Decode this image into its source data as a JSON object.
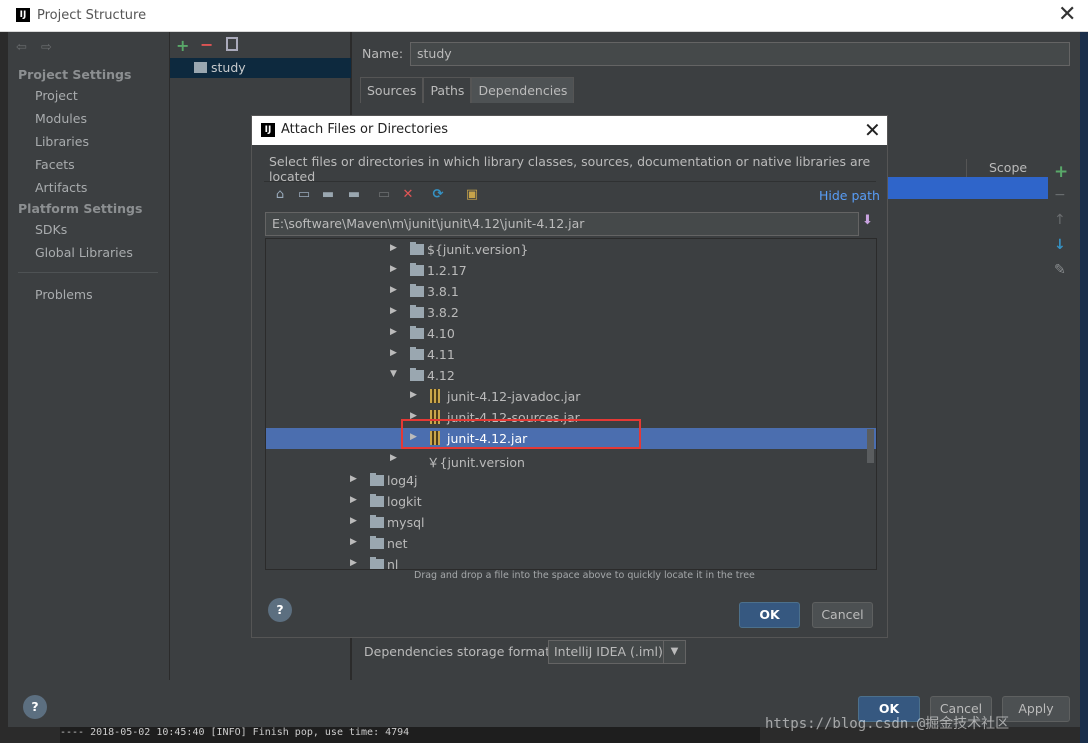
{
  "main": {
    "window_title": "Project Structure",
    "close_glyph": "✕",
    "logo": "IJ",
    "nav_back": "⇦",
    "nav_forward": "⇨",
    "nav": {
      "project_settings": "Project Settings",
      "project": "Project",
      "modules": "Modules",
      "libraries": "Libraries",
      "facets": "Facets",
      "artifacts": "Artifacts",
      "platform_settings": "Platform Settings",
      "sdks": "SDKs",
      "global_libraries": "Global Libraries",
      "problems": "Problems"
    },
    "module": "study",
    "name_label": "Name:",
    "name_value": "study",
    "tabs": [
      "Sources",
      "Paths",
      "Dependencies"
    ],
    "scope_header": "Scope",
    "storage_label": "Dependencies storage format:",
    "storage_value": "IntelliJ IDEA (.iml)",
    "buttons": {
      "ok": "OK",
      "cancel": "Cancel",
      "apply": "Apply"
    },
    "help": "?",
    "console": "---- 2018-05-02 10:45:40 [INFO] Finish pop, use time: 4794",
    "watermark": "https://blog.csdn.@掘金技术社区"
  },
  "dialog": {
    "title": "Attach Files or Directories",
    "logo": "IJ",
    "close_glyph": "✕",
    "description": "Select files or directories in which library classes, sources, documentation or native libraries are located",
    "hide_path": "Hide path",
    "path": "E:\\software\\Maven\\m\\junit\\junit\\4.12\\junit-4.12.jar",
    "tree": [
      "${junit.version}",
      "1.2.17",
      "3.8.1",
      "3.8.2",
      "4.10",
      "4.11",
      "4.12",
      "junit-4.12-javadoc.jar",
      "junit-4.12-sources.jar",
      "junit-4.12.jar",
      "￥{junit.version",
      "log4j",
      "logkit",
      "mysql",
      "net",
      "nl"
    ],
    "hint": "Drag and drop a file into the space above to quickly locate it in the tree",
    "ok": "OK",
    "cancel": "Cancel",
    "help": "?"
  }
}
